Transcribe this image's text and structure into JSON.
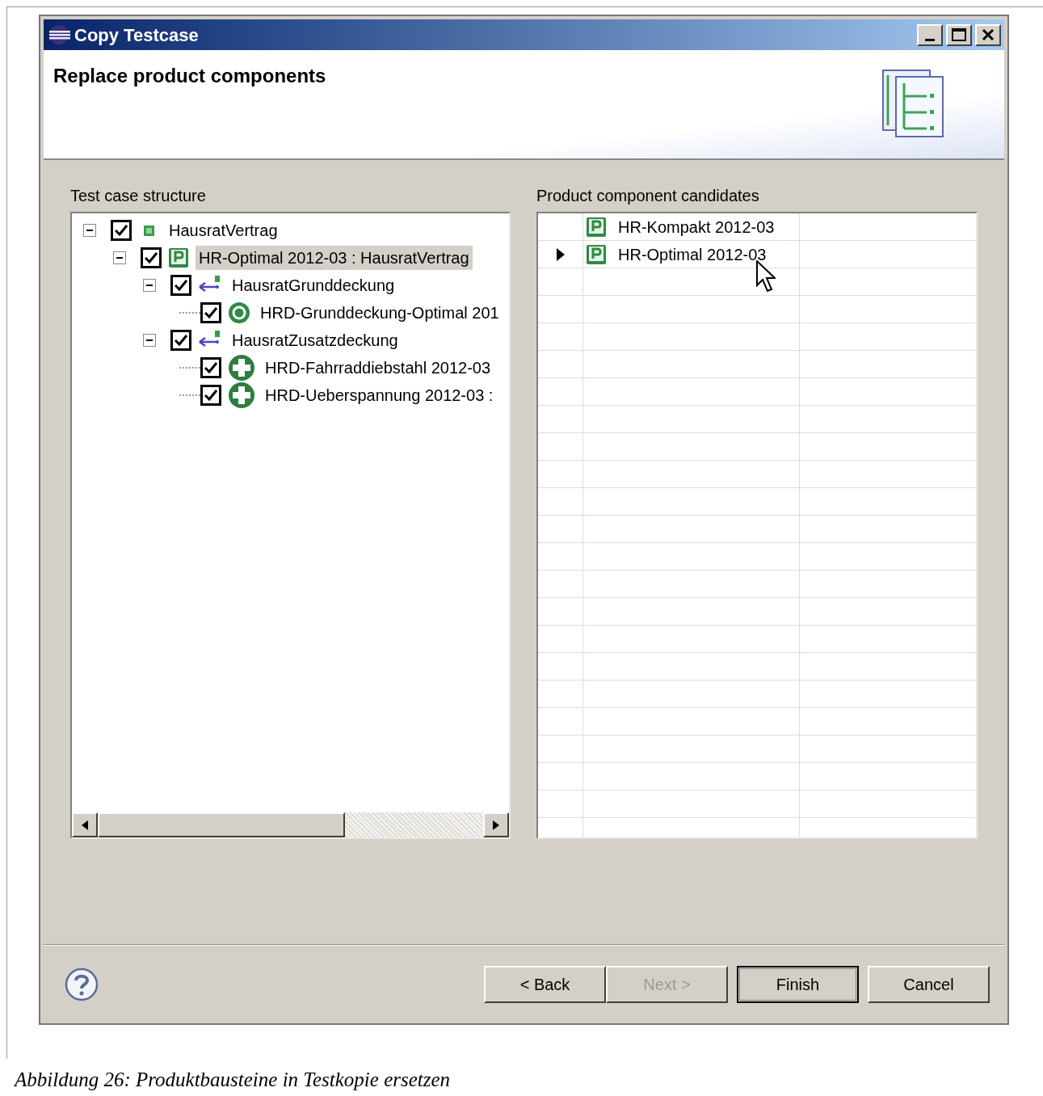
{
  "window": {
    "title": "Copy Testcase"
  },
  "header": {
    "title": "Replace product components"
  },
  "tree": {
    "label": "Test case structure",
    "items": [
      {
        "label": "HausratVertrag",
        "kind": "type",
        "checked": true,
        "expanded": true,
        "selected": false,
        "children": [
          {
            "label": "HR-Optimal 2012-03 : HausratVertrag",
            "kind": "product",
            "checked": true,
            "expanded": true,
            "selected": true,
            "children": [
              {
                "label": "HausratGrunddeckung",
                "kind": "association",
                "checked": true,
                "expanded": true,
                "selected": false,
                "children": [
                  {
                    "label": "HRD-Grunddeckung-Optimal 201",
                    "kind": "basic",
                    "checked": true,
                    "selected": false
                  }
                ]
              },
              {
                "label": "HausratZusatzdeckung",
                "kind": "association",
                "checked": true,
                "expanded": true,
                "selected": false,
                "children": [
                  {
                    "label": "HRD-Fahrraddiebstahl 2012-03",
                    "kind": "extra",
                    "checked": true,
                    "selected": false
                  },
                  {
                    "label": "HRD-Ueberspannung 2012-03 :",
                    "kind": "extra",
                    "checked": true,
                    "selected": false
                  }
                ]
              }
            ]
          }
        ]
      }
    ]
  },
  "candidates": {
    "label": "Product component candidates",
    "rows": [
      {
        "name": "HR-Kompakt 2012-03",
        "selected": false
      },
      {
        "name": "HR-Optimal 2012-03",
        "selected": true
      }
    ]
  },
  "buttons": [
    {
      "label": "< Back",
      "disabled": false,
      "default": false
    },
    {
      "label": "Next >",
      "disabled": true,
      "default": false
    },
    {
      "label": "Finish",
      "disabled": false,
      "default": true
    },
    {
      "label": "Cancel",
      "disabled": false,
      "default": false
    }
  ],
  "caption": "Abbildung 26: Produktbausteine in Testkopie ersetzen"
}
